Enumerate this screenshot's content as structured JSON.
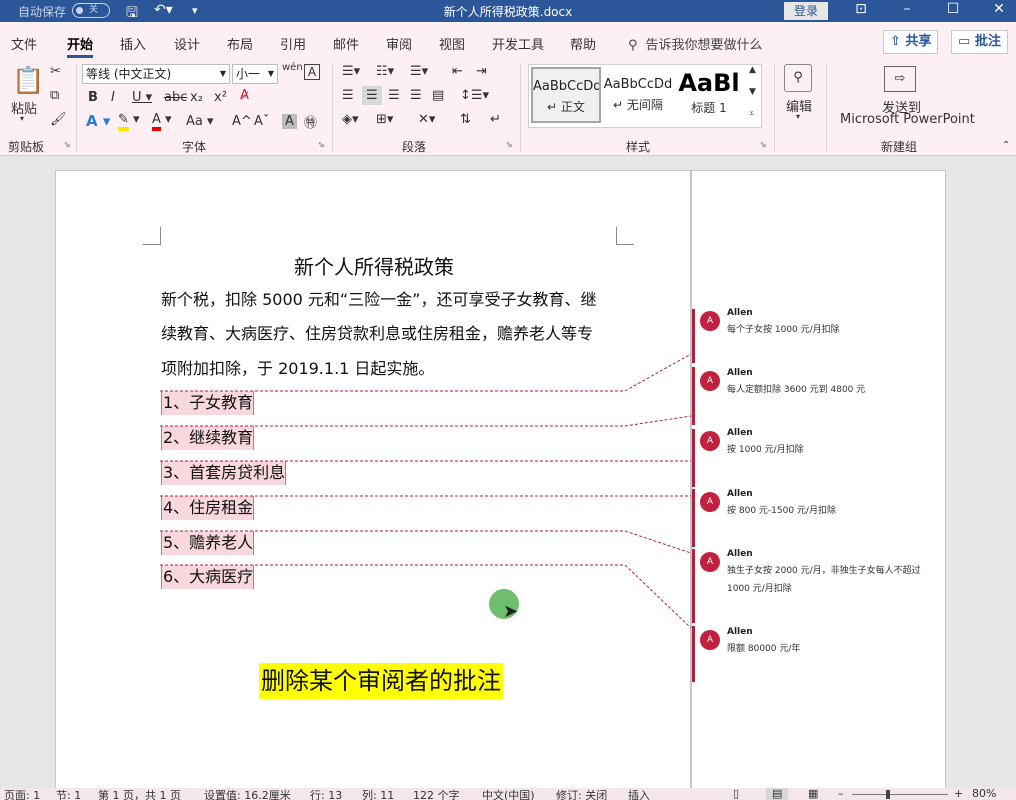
{
  "titlebar": {
    "autosave_label": "自动保存",
    "autosave_state": "关",
    "doc_title": "新个人所得税政策.docx",
    "login": "登录"
  },
  "ribbon_tabs": [
    "文件",
    "开始",
    "插入",
    "设计",
    "布局",
    "引用",
    "邮件",
    "审阅",
    "视图",
    "开发工具",
    "帮助"
  ],
  "active_tab": "开始",
  "tell_me": "告诉我你想要做什么",
  "share": "共享",
  "comment_btn": "批注",
  "clipboard": {
    "paste": "粘贴",
    "group": "剪贴板"
  },
  "font": {
    "name": "等线 (中文正文)",
    "size": "小一",
    "group": "字体"
  },
  "paragraph": {
    "group": "段落"
  },
  "styles": {
    "group": "样式",
    "items": [
      {
        "preview": "AaBbCcDd",
        "name": "正文"
      },
      {
        "preview": "AaBbCcDd",
        "name": "无间隔"
      },
      {
        "preview": "AaBl",
        "name": "标题 1"
      }
    ]
  },
  "editing": {
    "label": "编辑"
  },
  "newgroup": {
    "send": "发送到",
    "app": "Microsoft PowerPoint",
    "group": "新建组"
  },
  "document": {
    "title": "新个人所得税政策",
    "para1_line1": "新个税，扣除 5000 元和“三险一金”，还可享受子女教育、继",
    "para1_line2": "续教育、大病医疗、住房贷款利息或住房租金，赡养老人等专",
    "para1_line3": "项附加扣除，于 2019.1.1 日起实施。",
    "items": [
      "1、子女教育",
      "2、继续教育",
      "3、首套房贷利息",
      "4、住房租金",
      "5、赡养老人",
      "6、大病医疗"
    ],
    "caption": "删除某个审阅者的批注"
  },
  "comments": [
    {
      "avatar": "A",
      "author": "Allen",
      "text": "每个子女按 1000 元/月扣除"
    },
    {
      "avatar": "A",
      "author": "Allen",
      "text": "每人定额扣除 3600 元到 4800 元"
    },
    {
      "avatar": "A",
      "author": "Allen",
      "text": "按 1000 元/月扣除"
    },
    {
      "avatar": "A",
      "author": "Allen",
      "text": "按 800 元-1500 元/月扣除"
    },
    {
      "avatar": "A",
      "author": "Allen",
      "text": "独生子女按 2000 元/月，非独生子女每人不超过 1000 元/月扣除"
    },
    {
      "avatar": "A",
      "author": "Allen",
      "text": "限额 80000 元/年"
    }
  ],
  "status": {
    "page": "页面: 1",
    "section": "节: 1",
    "pages": "第 1 页，共 1 页",
    "position": "设置值: 16.2厘米",
    "row": "行: 13",
    "col": "列: 11",
    "words": "122 个字",
    "lang": "中文(中国)",
    "track": "修订: 关闭",
    "insert": "插入",
    "zoom": "80%"
  },
  "colors": {
    "titlebar": "#2b579a",
    "ribbon": "#fdf0f4",
    "comment": "#b0203f",
    "highlight": "#ffff00"
  }
}
